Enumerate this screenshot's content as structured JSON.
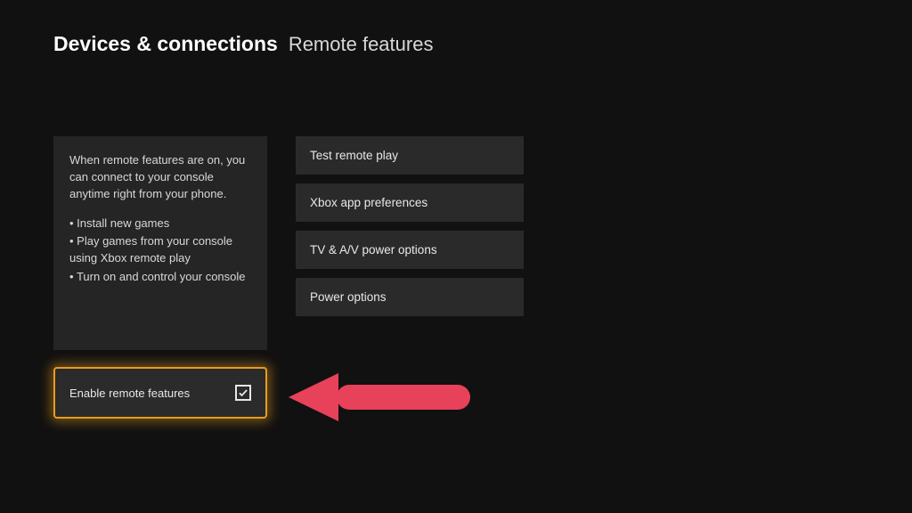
{
  "header": {
    "breadcrumb_bold": "Devices & connections",
    "breadcrumb_light": "Remote features"
  },
  "info": {
    "intro": "When remote features are on, you can connect to your console anytime right from your phone.",
    "bullets": [
      "Install new games",
      "Play games from your console using Xbox remote play",
      "Turn on and control your console"
    ]
  },
  "menu": [
    {
      "label": "Test remote play"
    },
    {
      "label": "Xbox app preferences"
    },
    {
      "label": "TV & A/V power options"
    },
    {
      "label": "Power options"
    }
  ],
  "enable": {
    "label": "Enable remote features",
    "checked": true
  },
  "colors": {
    "highlight": "#e89b1f",
    "annotation_arrow": "#e8415a"
  }
}
